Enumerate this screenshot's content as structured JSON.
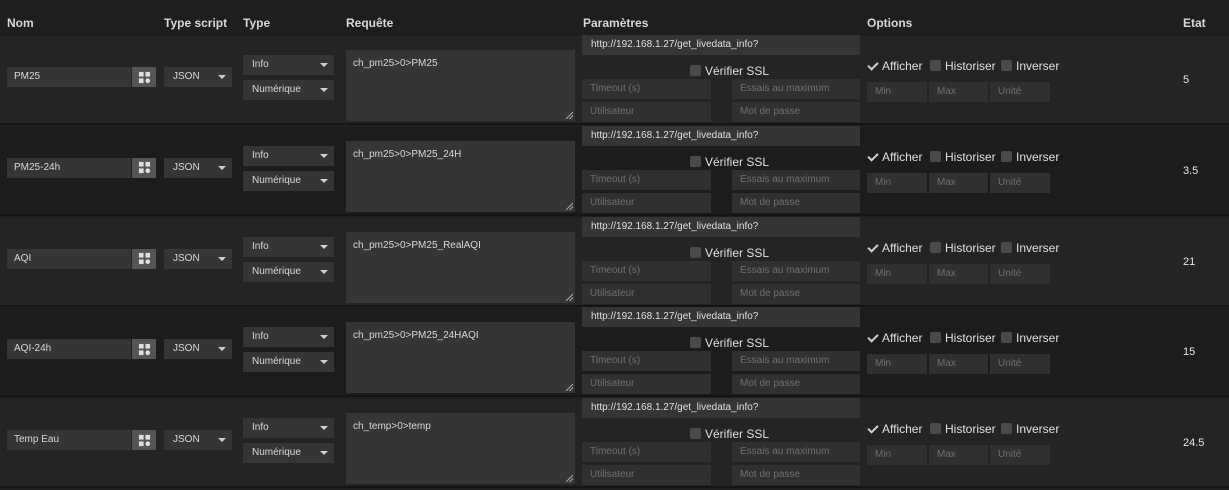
{
  "header": {
    "nom": "Nom",
    "type_script": "Type script",
    "type": "Type",
    "requete": "Requête",
    "parametres": "Paramètres",
    "options": "Options",
    "etat": "Etat"
  },
  "placeholders": {
    "timeout": "Timeout (s)",
    "essais": "Essais au maximum",
    "utilisateur": "Utilisateur",
    "mot_de_passe": "Mot de passe",
    "min": "Min",
    "max": "Max",
    "unite": "Unité"
  },
  "labels": {
    "verifier_ssl": "Vérifier SSL",
    "afficher": "Afficher",
    "historiser": "Historiser",
    "inverser": "Inverser"
  },
  "rows": [
    {
      "name": "PM25",
      "script": "JSON",
      "type": "Info",
      "subtype": "Numérique",
      "query": "ch_pm25>0>PM25",
      "url": "http://192.168.1.27/get_livedata_info?",
      "afficher": true,
      "historiser": false,
      "inverser": false,
      "verifier_ssl": false,
      "etat": "5"
    },
    {
      "name": "PM25-24h",
      "script": "JSON",
      "type": "Info",
      "subtype": "Numérique",
      "query": "ch_pm25>0>PM25_24H",
      "url": "http://192.168.1.27/get_livedata_info?",
      "afficher": true,
      "historiser": false,
      "inverser": false,
      "verifier_ssl": false,
      "etat": "3.5"
    },
    {
      "name": "AQI",
      "script": "JSON",
      "type": "Info",
      "subtype": "Numérique",
      "query": "ch_pm25>0>PM25_RealAQI",
      "url": "http://192.168.1.27/get_livedata_info?",
      "afficher": true,
      "historiser": false,
      "inverser": false,
      "verifier_ssl": false,
      "etat": "21"
    },
    {
      "name": "AQI-24h",
      "script": "JSON",
      "type": "Info",
      "subtype": "Numérique",
      "query": "ch_pm25>0>PM25_24HAQI",
      "url": "http://192.168.1.27/get_livedata_info?",
      "afficher": true,
      "historiser": false,
      "inverser": false,
      "verifier_ssl": false,
      "etat": "15"
    },
    {
      "name": "Temp Eau",
      "script": "JSON",
      "type": "Info",
      "subtype": "Numérique",
      "query": "ch_temp>0>temp",
      "url": "http://192.168.1.27/get_livedata_info?",
      "afficher": true,
      "historiser": false,
      "inverser": false,
      "verifier_ssl": false,
      "etat": "24.5"
    }
  ]
}
